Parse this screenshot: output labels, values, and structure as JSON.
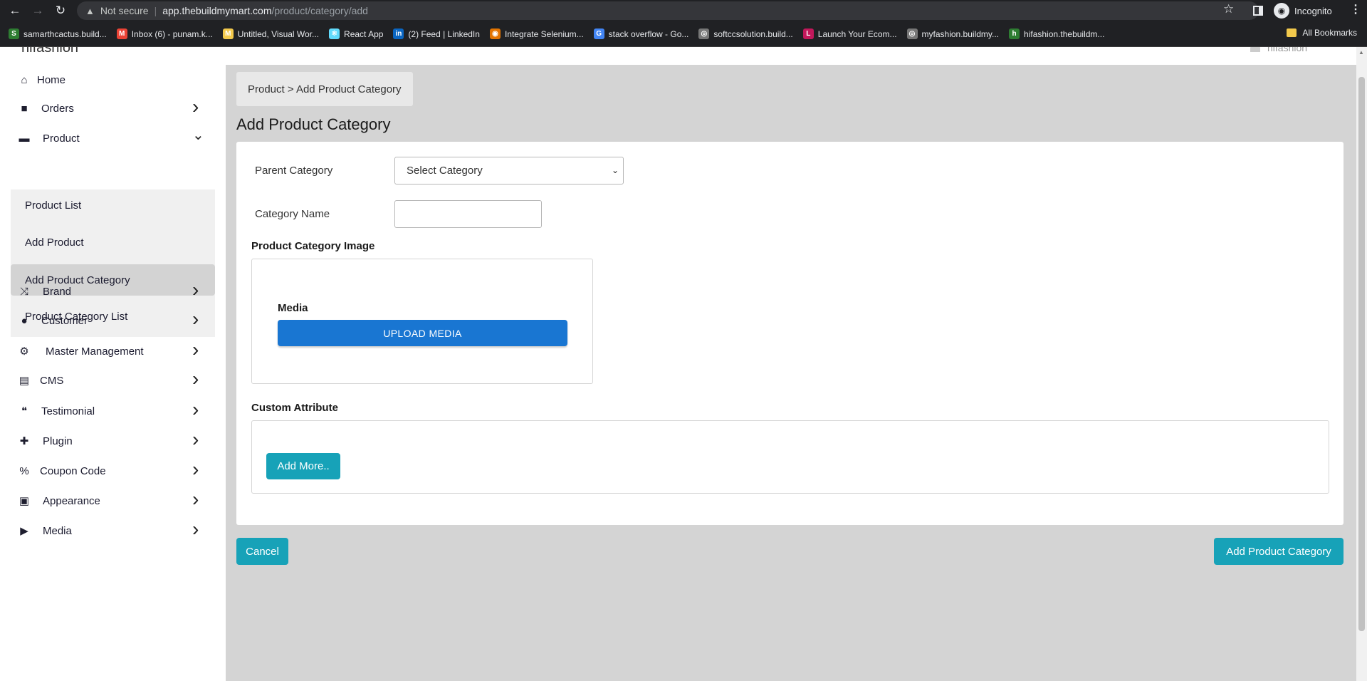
{
  "browser": {
    "url_warning": "Not secure",
    "url_host": "app.thebuildmymart.com",
    "url_path": "/product/category/add",
    "profile_label": "Incognito",
    "bookmarks": [
      {
        "label": "samarthcactus.build...",
        "color": "#2e7d32",
        "glyph": "S"
      },
      {
        "label": "Inbox (6) - punam.k...",
        "color": "#ea4335",
        "glyph": "M"
      },
      {
        "label": "Untitled, Visual Wor...",
        "color": "#f2c94c",
        "glyph": "M"
      },
      {
        "label": "React App",
        "color": "#61dafb",
        "glyph": "⚛"
      },
      {
        "label": "(2) Feed | LinkedIn",
        "color": "#0a66c2",
        "glyph": "in"
      },
      {
        "label": "Integrate Selenium...",
        "color": "#e37400",
        "glyph": "◉"
      },
      {
        "label": "stack overflow - Go...",
        "color": "#4285f4",
        "glyph": "G"
      },
      {
        "label": "softccsolution.build...",
        "color": "#777777",
        "glyph": "◎"
      },
      {
        "label": "Launch Your Ecom...",
        "color": "#c2185b",
        "glyph": "L"
      },
      {
        "label": "myfashion.buildmy...",
        "color": "#777777",
        "glyph": "◎"
      },
      {
        "label": "hifashion.thebuildm...",
        "color": "#2e7d32",
        "glyph": "h"
      }
    ],
    "all_bookmarks_label": "All Bookmarks"
  },
  "app": {
    "brand": "hifashion",
    "user_name": "hifashion"
  },
  "sidebar": {
    "items": [
      {
        "label": "Home",
        "icon": "home-icon",
        "glyph": "⌂"
      },
      {
        "label": "Orders",
        "icon": "shopping-bag-icon",
        "glyph": "■"
      },
      {
        "label": "Product",
        "icon": "archive-icon",
        "glyph": "▬"
      },
      {
        "label": "Brand",
        "icon": "shuffle-icon",
        "glyph": "⤨"
      },
      {
        "label": "Customer",
        "icon": "user-icon",
        "glyph": "●"
      },
      {
        "label": "Master Management",
        "icon": "user-gear-icon",
        "glyph": "⚙"
      },
      {
        "label": "CMS",
        "icon": "file-icon",
        "glyph": "▤"
      },
      {
        "label": "Testimonial",
        "icon": "quote-icon",
        "glyph": "❝"
      },
      {
        "label": "Plugin",
        "icon": "puzzle-icon",
        "glyph": "✚"
      },
      {
        "label": "Coupon Code",
        "icon": "percent-icon",
        "glyph": "%"
      },
      {
        "label": "Appearance",
        "icon": "image-icon",
        "glyph": "▣"
      },
      {
        "label": "Media",
        "icon": "play-circle-icon",
        "glyph": "▶"
      }
    ],
    "product_submenu": [
      {
        "label": "Product List"
      },
      {
        "label": "Add Product"
      },
      {
        "label": "Add Product Category",
        "active": true
      },
      {
        "label": "Product Category List"
      }
    ]
  },
  "main": {
    "breadcrumb": "Product > Add Product Category",
    "title": "Add Product Category",
    "form": {
      "parent_category_label": "Parent Category",
      "parent_category_value": "Select Category",
      "category_name_label": "Category Name",
      "category_name_value": "",
      "image_section_title": "Product Category Image",
      "media_label": "Media",
      "upload_button": "UPLOAD MEDIA",
      "custom_attribute_title": "Custom Attribute",
      "add_more_button": "Add More.."
    },
    "cancel_button": "Cancel",
    "submit_button": "Add Product Category"
  },
  "colors": {
    "primary_blue": "#1976d2",
    "teal": "#17a2b8",
    "page_bg": "#d4d4d4"
  }
}
